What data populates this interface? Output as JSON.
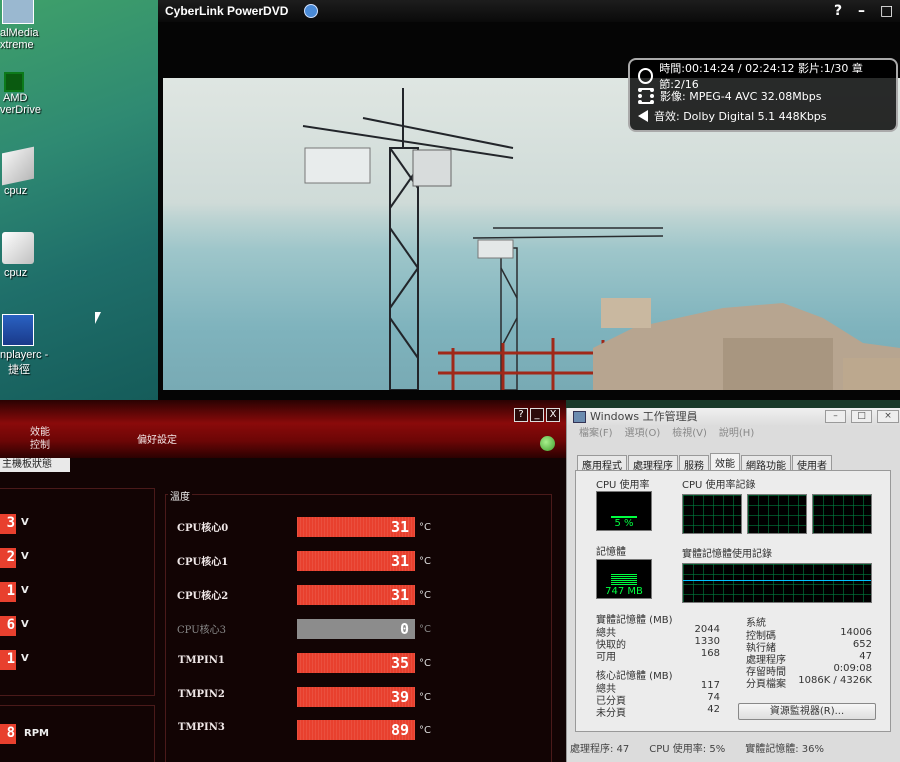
{
  "desktop": {
    "icons": [
      {
        "label_line1": "alMedia",
        "label_line2": "xtreme"
      },
      {
        "label_line1": "AMD",
        "label_line2": "verDrive"
      },
      {
        "label_line1": "cpuz",
        "label_line2": ""
      },
      {
        "label_line1": "cpuz",
        "label_line2": ""
      },
      {
        "label_line1": "nplayerc -",
        "label_line2": "捷徑"
      }
    ]
  },
  "powerdvd": {
    "title": "CyberLink PowerDVD",
    "help": "?",
    "minimize": "–",
    "maximize": "□",
    "osd": {
      "time": "時間:00:14:24 / 02:24:12   影片:1/30   章節:2/16",
      "video": "影像: MPEG-4 AVC  32.08Mbps",
      "audio": "音效: Dolby Digital 5.1   448Kbps"
    }
  },
  "monitor_app": {
    "tabs": {
      "perf_line1": "效能",
      "perf_line2": "控制",
      "prefs": "偏好設定"
    },
    "window_buttons": {
      "help": "?",
      "min": "_",
      "close": "X"
    },
    "board_tab": "主機板狀態",
    "temp_group": "溫度",
    "voltages": [
      {
        "value": "3",
        "unit": "V"
      },
      {
        "value": "2",
        "unit": "V"
      },
      {
        "value": "1",
        "unit": "V"
      },
      {
        "value": "6",
        "unit": "V"
      },
      {
        "value": "1",
        "unit": "V"
      }
    ],
    "fan": {
      "value": "8",
      "unit": "RPM"
    },
    "temps": [
      {
        "label": "CPU核心0",
        "value": "31",
        "unit": "°C"
      },
      {
        "label": "CPU核心1",
        "value": "31",
        "unit": "°C"
      },
      {
        "label": "CPU核心2",
        "value": "31",
        "unit": "°C"
      },
      {
        "label": "CPU核心3",
        "value": "0",
        "unit": "°C"
      },
      {
        "label": "TMPIN1",
        "value": "35",
        "unit": "°C"
      },
      {
        "label": "TMPIN2",
        "value": "39",
        "unit": "°C"
      },
      {
        "label": "TMPIN3",
        "value": "89",
        "unit": "°C"
      }
    ],
    "accent": "#e8402e"
  },
  "taskmgr": {
    "title": "Windows 工作管理員",
    "menu": [
      "檔案(F)",
      "選項(O)",
      "檢視(V)",
      "說明(H)"
    ],
    "tabs": [
      "應用程式",
      "處理程序",
      "服務",
      "效能",
      "網路功能",
      "使用者"
    ],
    "active_tab": "效能",
    "cpu_usage_label": "CPU 使用率",
    "cpu_usage_value": "5 %",
    "cpu_history_label": "CPU 使用率記錄",
    "memory_label": "記憶體",
    "memory_value": "747 MB",
    "mem_history_label": "實體記憶體使用記錄",
    "physical_mem": {
      "header": "實體記憶體 (MB)",
      "rows": [
        {
          "label": "總共",
          "value": "2044"
        },
        {
          "label": "快取的",
          "value": "1330"
        },
        {
          "label": "可用",
          "value": "168"
        }
      ]
    },
    "kernel_mem": {
      "header": "核心記憶體 (MB)",
      "rows": [
        {
          "label": "總共",
          "value": "117"
        },
        {
          "label": "已分頁",
          "value": "74"
        },
        {
          "label": "未分頁",
          "value": "42"
        }
      ]
    },
    "system": {
      "header": "系統",
      "rows": [
        {
          "label": "控制碼",
          "value": "14006"
        },
        {
          "label": "執行緒",
          "value": "652"
        },
        {
          "label": "處理程序",
          "value": "47"
        },
        {
          "label": "存留時間",
          "value": "0:09:08"
        },
        {
          "label": "分頁檔案",
          "value": "1086K / 4326K"
        }
      ]
    },
    "resource_button": "資源監視器(R)...",
    "status": {
      "processes": "處理程序: 47",
      "cpu": "CPU 使用率: 5%",
      "memory": "實體記憶體: 36%"
    }
  }
}
